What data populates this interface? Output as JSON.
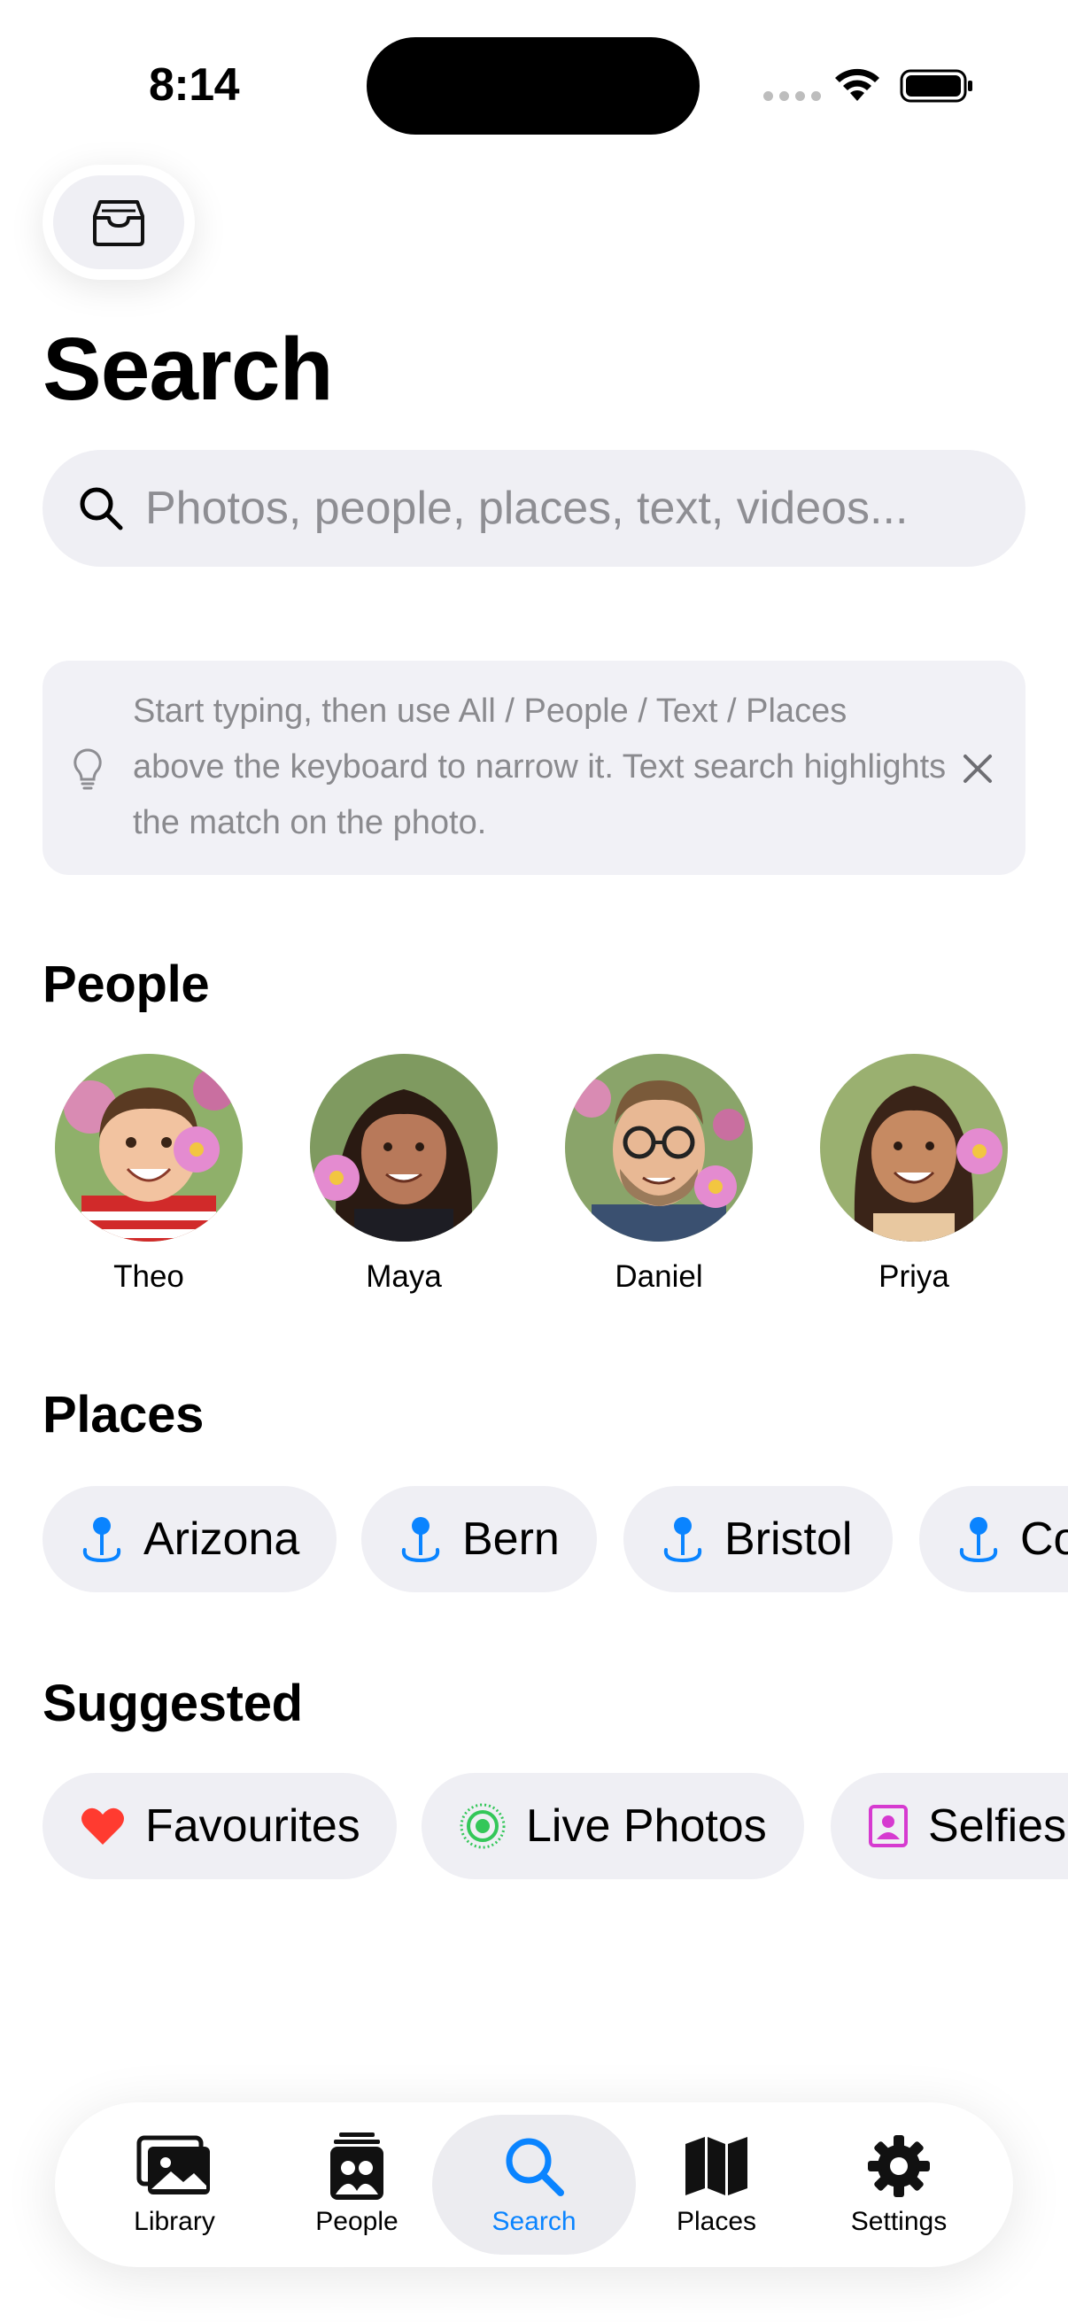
{
  "status_bar": {
    "time": "8:14"
  },
  "header": {
    "title": "Search",
    "inbox_icon": "tray-icon"
  },
  "search": {
    "placeholder": "Photos, people, places, text, videos...",
    "value": ""
  },
  "tip": {
    "text": "Start typing, then use All / People / Text / Places above the keyboard to narrow it. Text search highlights the match on the photo.",
    "icon": "lightbulb-icon"
  },
  "people": {
    "title": "People",
    "items": [
      {
        "name": "Theo"
      },
      {
        "name": "Maya"
      },
      {
        "name": "Daniel"
      },
      {
        "name": "Priya"
      }
    ]
  },
  "places": {
    "title": "Places",
    "items": [
      {
        "label": "Arizona"
      },
      {
        "label": "Bern"
      },
      {
        "label": "Bristol"
      },
      {
        "label": "Co"
      }
    ]
  },
  "suggested": {
    "title": "Suggested",
    "items": [
      {
        "label": "Favourites",
        "icon": "heart-icon",
        "color": "#ff3b30"
      },
      {
        "label": "Live Photos",
        "icon": "live-photos-icon",
        "color": "#34c759"
      },
      {
        "label": "Selfies",
        "icon": "selfie-icon",
        "color": "#d63ad0"
      }
    ]
  },
  "tabbar": {
    "items": [
      {
        "label": "Library",
        "icon": "photos-stack-icon"
      },
      {
        "label": "People",
        "icon": "people-icon"
      },
      {
        "label": "Search",
        "icon": "search-icon",
        "active": true
      },
      {
        "label": "Places",
        "icon": "map-icon"
      },
      {
        "label": "Settings",
        "icon": "gear-icon"
      }
    ]
  },
  "colors": {
    "accent": "#0a84ff",
    "chip_bg": "#efeff4",
    "place_pin": "#0a84ff"
  }
}
